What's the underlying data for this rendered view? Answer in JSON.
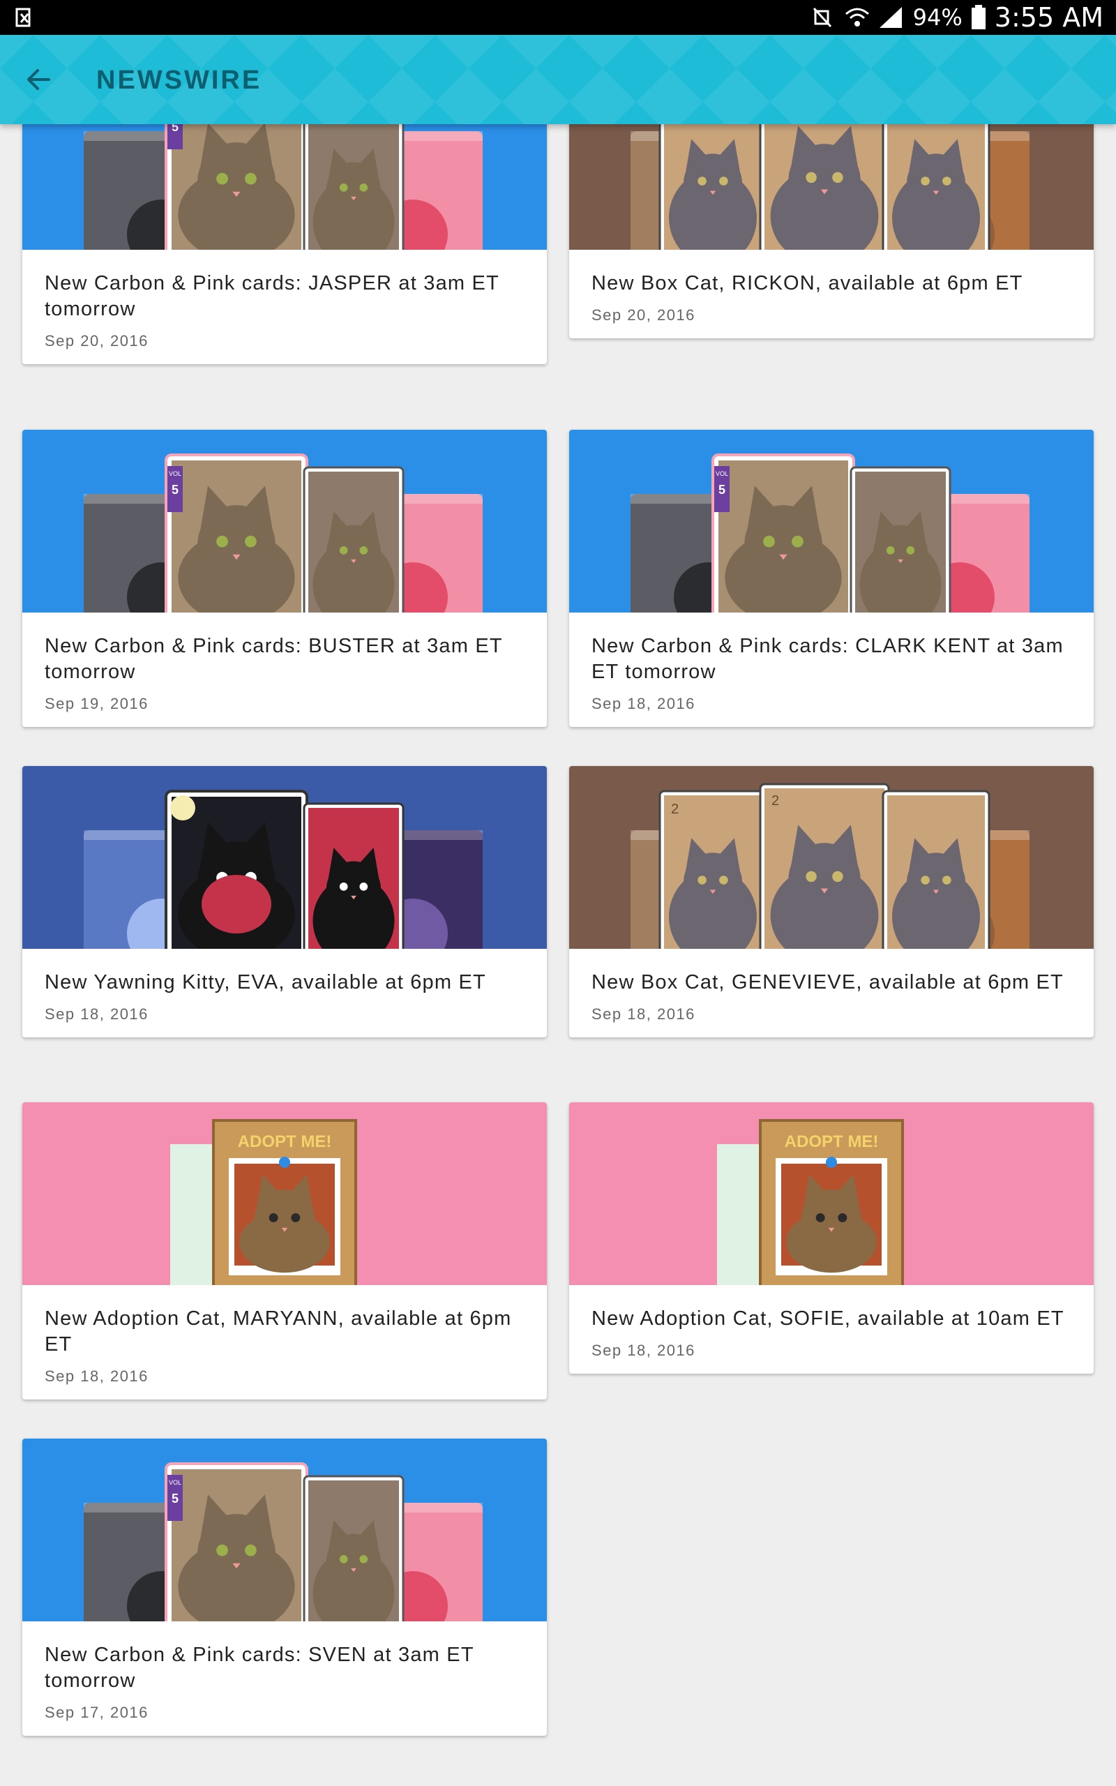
{
  "status_bar": {
    "battery": "94%",
    "time": "3:55 AM",
    "icons": [
      "screenshot-icon",
      "mute-icon",
      "wifi-icon",
      "signal-icon",
      "battery-icon"
    ]
  },
  "app_bar": {
    "title": "NEWSWIRE",
    "back_icon": "arrow-back-icon",
    "color": "#1ebcd6",
    "title_color": "#0d5e6e"
  },
  "cards": [
    {
      "title": "New Carbon & Pink cards: JASPER at 3am ET tomorrow",
      "date": "Sep 20, 2016",
      "theme": "carbon-pink"
    },
    {
      "title": "New Box Cat, RICKON, available at 6pm ET",
      "date": "Sep 20, 2016",
      "theme": "box"
    },
    {
      "title": "New Carbon & Pink cards: BUSTER at 3am ET tomorrow",
      "date": "Sep 19, 2016",
      "theme": "carbon-pink"
    },
    {
      "title": "New Carbon & Pink cards: CLARK KENT at 3am ET tomorrow",
      "date": "Sep 18, 2016",
      "theme": "carbon-pink"
    },
    {
      "title": "New Yawning Kitty, EVA, available at 6pm ET",
      "date": "Sep 18, 2016",
      "theme": "yawning"
    },
    {
      "title": "New Box Cat, GENEVIEVE, available at 6pm ET",
      "date": "Sep 18, 2016",
      "theme": "box"
    },
    {
      "title": "New Adoption Cat, MARYANN, available at 6pm ET",
      "date": "Sep 18, 2016",
      "theme": "adoption"
    },
    {
      "title": "New Adoption Cat, SOFIE, available at 10am ET",
      "date": "Sep 18, 2016",
      "theme": "adoption"
    },
    {
      "title": "New Carbon & Pink cards: SVEN at 3am ET tomorrow",
      "date": "Sep 17, 2016",
      "theme": "carbon-pink"
    }
  ],
  "card_badges": {
    "vol": "VOL",
    "vol_number": "5",
    "box_number": "2",
    "adopt_label": "ADOPT ME!"
  },
  "theme_colors": {
    "carbon-pink": "#2b8fe8",
    "box": "#7a5a4a",
    "yawning": "#3b5ba8",
    "adoption": "#f48fb1"
  }
}
